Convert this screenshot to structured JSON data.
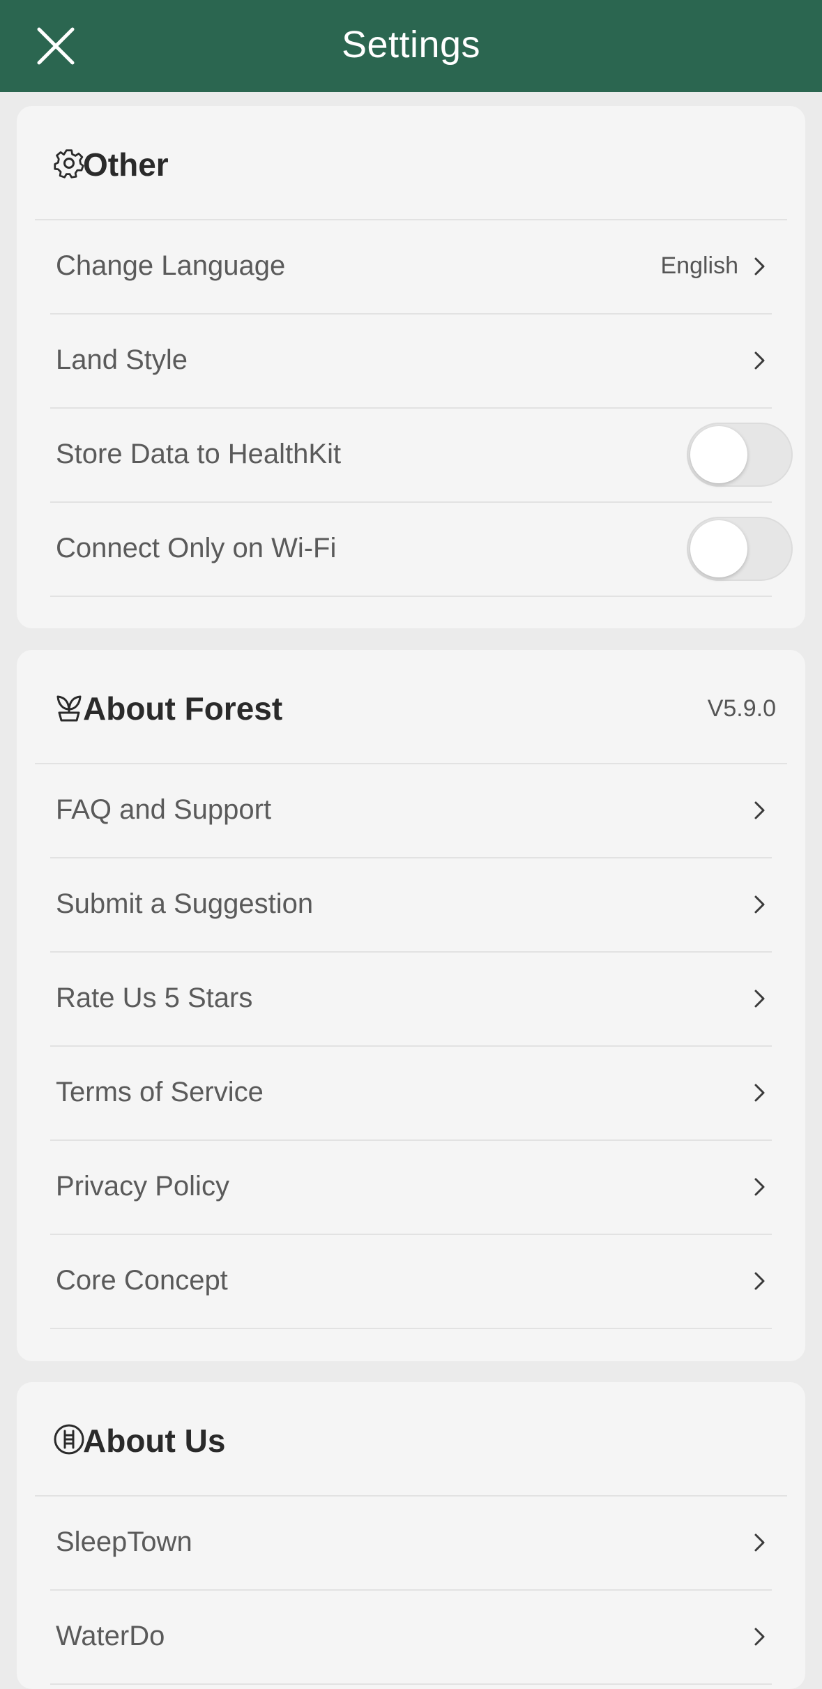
{
  "header": {
    "title": "Settings",
    "close_icon": "close-icon"
  },
  "colors": {
    "header_bg": "#2b6650",
    "card_bg": "#f5f5f5",
    "page_bg": "#ebebeb"
  },
  "other": {
    "title": "Other",
    "icon": "gear-icon",
    "items": [
      {
        "label": "Change Language",
        "value": "English"
      },
      {
        "label": "Land Style"
      },
      {
        "label": "Store Data to HealthKit",
        "toggle_on": false
      },
      {
        "label": "Connect Only on Wi-Fi",
        "toggle_on": false
      }
    ]
  },
  "about_forest": {
    "title": "About Forest",
    "icon": "sprout-icon",
    "version": "V5.9.0",
    "items": [
      {
        "label": "FAQ and Support"
      },
      {
        "label": "Submit a Suggestion"
      },
      {
        "label": "Rate Us 5 Stars"
      },
      {
        "label": "Terms of Service"
      },
      {
        "label": "Privacy Policy"
      },
      {
        "label": "Core Concept"
      }
    ]
  },
  "about_us": {
    "title": "About Us",
    "icon": "ladder-circle-icon",
    "items": [
      {
        "label": "SleepTown"
      },
      {
        "label": "WaterDo"
      }
    ]
  }
}
